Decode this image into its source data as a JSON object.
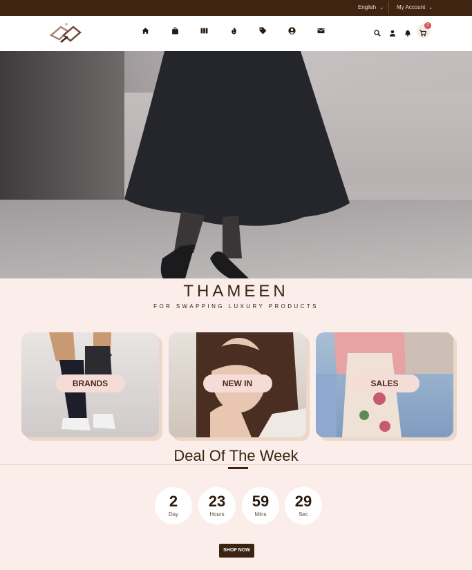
{
  "topbar": {
    "language": "English",
    "account": "My Account"
  },
  "header": {
    "nav_icons": [
      "home-icon",
      "bag-icon",
      "grid-icon",
      "fire-icon",
      "tag-icon",
      "user-circle-icon",
      "mail-icon"
    ],
    "right_icons": [
      "search-icon",
      "user-icon",
      "bell-icon",
      "cart-icon"
    ],
    "cart_count": "2"
  },
  "brand": {
    "title": "THAMEEN",
    "subtitle": "FOR SWAPPING LUXURY PRODUCTS"
  },
  "categories": [
    {
      "label": "BRANDS"
    },
    {
      "label": "NEW IN"
    },
    {
      "label": "SALES"
    }
  ],
  "deal": {
    "title": "Deal Of The Week",
    "countdown": [
      {
        "value": "2",
        "unit": "Day"
      },
      {
        "value": "23",
        "unit": "Hours"
      },
      {
        "value": "59",
        "unit": "Mins"
      },
      {
        "value": "29",
        "unit": "Sec"
      }
    ],
    "button_label": "SHOP NOW"
  },
  "colors": {
    "brand_dark": "#3e2411",
    "background": "#fbeeea",
    "pill": "#f6dcd7",
    "badge": "#d9534f"
  }
}
